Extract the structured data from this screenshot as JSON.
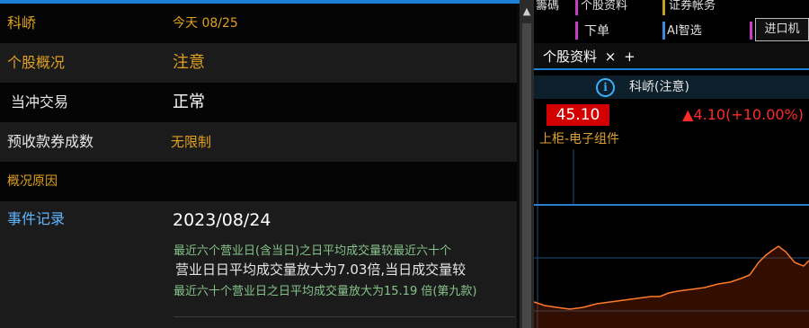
{
  "info_panel": {
    "stock_name": "科峤",
    "date": "今天 08/25",
    "rows": [
      {
        "label": "个股概况",
        "value": "注意",
        "value_color": "#e0a020"
      },
      {
        "label": "当冲交易",
        "value": "正常",
        "value_color": "#ffffff"
      },
      {
        "label": "预收款券成数",
        "value": "无限制",
        "value_color": "#e0a020"
      },
      {
        "label": "概况原因",
        "value": ""
      }
    ],
    "event": {
      "label": "事件记录",
      "date": "2023/08/24",
      "lines": [
        "最近六个营业日(含当日)之日平均成交量较最近六十个",
        "营业日日平均成交量放大为7.03倍,当日成交量较",
        "最近六十个营业日之日平均成交量放大为15.19 倍(第九款)"
      ]
    }
  },
  "toolbar": {
    "items": [
      "籌碼",
      "个股资料",
      "证券帐务",
      "下单",
      "AI智选",
      "进口机"
    ]
  },
  "tab": {
    "label": "个股资料",
    "close": "×",
    "add": "+"
  },
  "quote": {
    "name": "科峤(注意)",
    "price": "45.10",
    "change": "▲4.10(+10.00%)",
    "sector": "上柜-电子组件"
  },
  "colors": {
    "accent_blue": "#1e7fd6",
    "up_red": "#ff2a2a",
    "price_bg": "#d20000",
    "label_orange": "#e0a030",
    "chart_line": "#ff7a2a"
  },
  "icons": [
    "info-icon",
    "scroll-up-icon",
    "close-icon",
    "plus-icon"
  ]
}
